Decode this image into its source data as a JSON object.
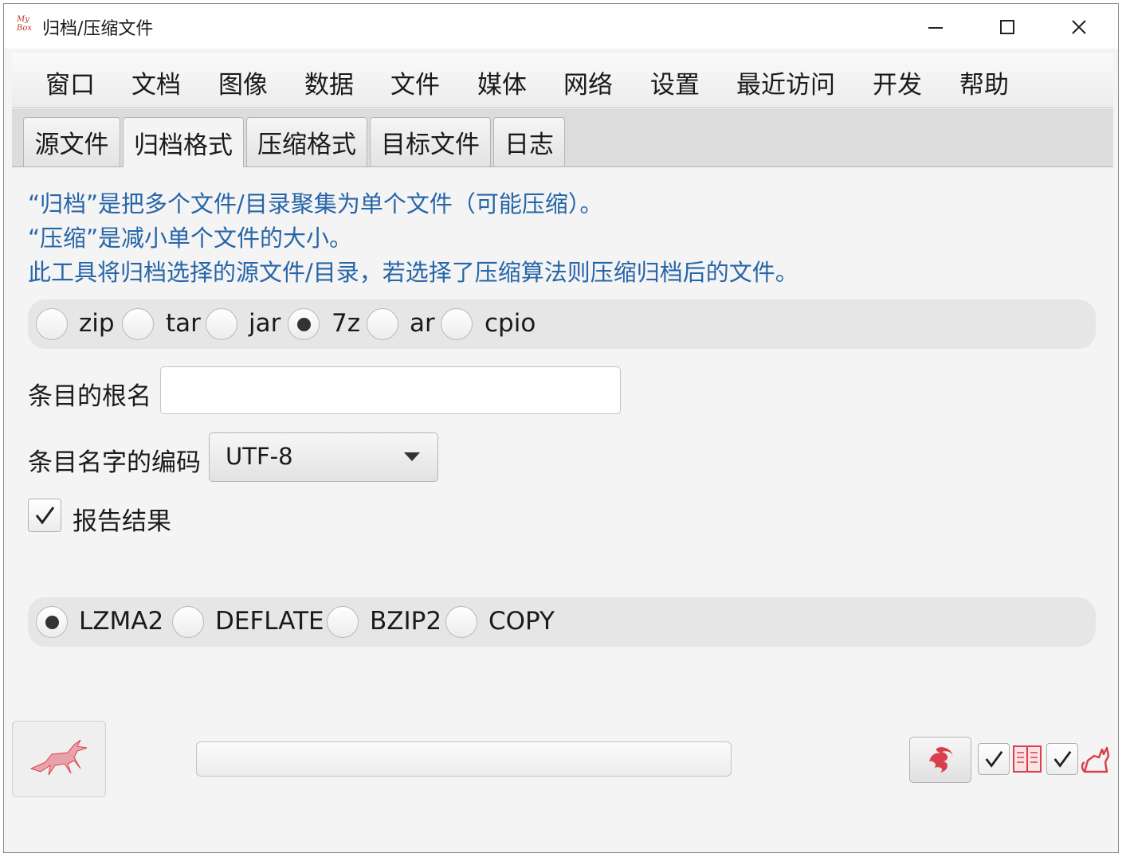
{
  "window": {
    "title": "归档/压缩文件",
    "logo_top": "My",
    "logo_bottom": "Box",
    "controls": [
      "minimize-icon",
      "maximize-icon",
      "close-icon"
    ]
  },
  "menu": {
    "items": [
      "窗口",
      "文档",
      "图像",
      "数据",
      "文件",
      "媒体",
      "网络",
      "设置",
      "最近访问",
      "开发",
      "帮助"
    ]
  },
  "tabs": {
    "items": [
      "源文件",
      "归档格式",
      "压缩格式",
      "目标文件",
      "日志"
    ],
    "active": "归档格式"
  },
  "info": {
    "line1": "“归档”是把多个文件/目录聚集为单个文件（可能压缩）。",
    "line2": "“压缩”是减小单个文件的大小。",
    "line3": "此工具将归档选择的源文件/目录，若选择了压缩算法则压缩归档后的文件。"
  },
  "archive_format": {
    "options": [
      "zip",
      "tar",
      "jar",
      "7z",
      "ar",
      "cpio"
    ],
    "selected": "7z"
  },
  "entry_root": {
    "label": "条目的根名",
    "value": ""
  },
  "entry_encoding": {
    "label": "条目名字的编码",
    "value": "UTF-8"
  },
  "report": {
    "label": "报告结果",
    "checked": true
  },
  "compression_method": {
    "options": [
      "LZMA2",
      "DEFLATE",
      "BZIP2",
      "COPY"
    ],
    "selected": "LZMA2"
  },
  "bottom": {
    "run_icon": "running-deer-icon",
    "progress": 0,
    "icons": [
      "pattern-icon",
      "book-icon",
      "cat-icon"
    ],
    "accent": "#d9404b"
  }
}
